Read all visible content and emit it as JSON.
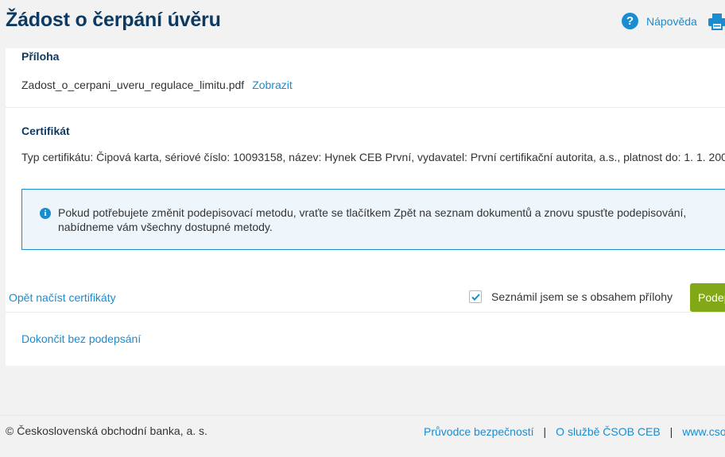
{
  "header": {
    "title": "Žádost o čerpání úvěru",
    "help_icon_glyph": "?",
    "help_label": "Nápověda",
    "print_icon": "printer-icon"
  },
  "attachment": {
    "title": "Příloha",
    "file_name": "Zadost_o_cerpani_uveru_regulace_limitu.pdf",
    "view_label": "Zobrazit"
  },
  "certificate": {
    "title": "Certifikát",
    "text": "Typ certifikátu: Čipová karta, sériové číslo: 10093158, název: Hynek CEB První, vydavatel: První certifikační autorita, a.s., platnost do: 1. 1. 200"
  },
  "info": {
    "icon_glyph": "i",
    "text": "Pokud potřebujete změnit podepisovací metodu, vraťte se tlačítkem Zpět na seznam dokumentů a znovu spusťte podepisování, nabídneme vám všechny dostupné metody."
  },
  "actions": {
    "reload_certificates": "Opět načíst certifikáty",
    "confirm_label": "Seznámil jsem se s obsahem přílohy",
    "confirm_checked": true,
    "sign_button": "Podep",
    "finish_without_signing": "Dokončit bez podepsání"
  },
  "footer": {
    "copyright": "© Československá obchodní banka, a. s.",
    "links": [
      "Průvodce bezpečností",
      "O službě ČSOB CEB",
      "www.csob"
    ],
    "separator": "|"
  },
  "colors": {
    "title": "#0d3a63",
    "link": "#1a8ccf",
    "primary_button": "#82a817",
    "info_border": "#1a8ccf",
    "info_background": "#eff6fb"
  }
}
